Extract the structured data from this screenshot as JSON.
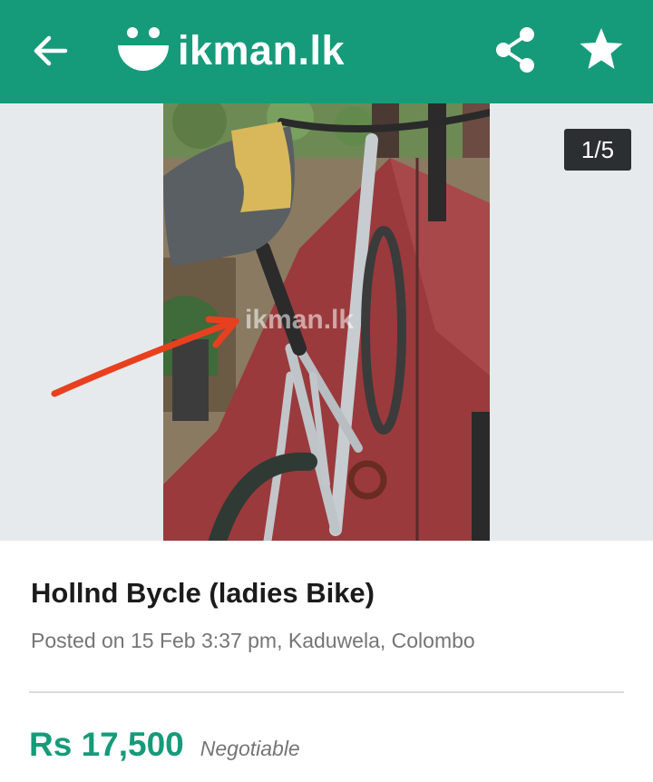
{
  "header": {
    "brand": "ikman.lk",
    "icons": [
      "back-arrow-icon",
      "ikman-logo-icon",
      "share-icon",
      "star-icon"
    ],
    "background_color": "#169b7a"
  },
  "gallery": {
    "counter": "1/5",
    "watermark": "ikman.lk",
    "photo_subject": "ladies bicycle with torn saddle",
    "background_color": "#e6eaed"
  },
  "listing": {
    "title": "Hollnd Bycle (ladies Bike)",
    "posted": "Posted on 15 Feb 3:37 pm, Kaduwela, Colombo",
    "price": "Rs 17,500",
    "price_note": "Negotiable",
    "price_color": "#169b7a"
  }
}
